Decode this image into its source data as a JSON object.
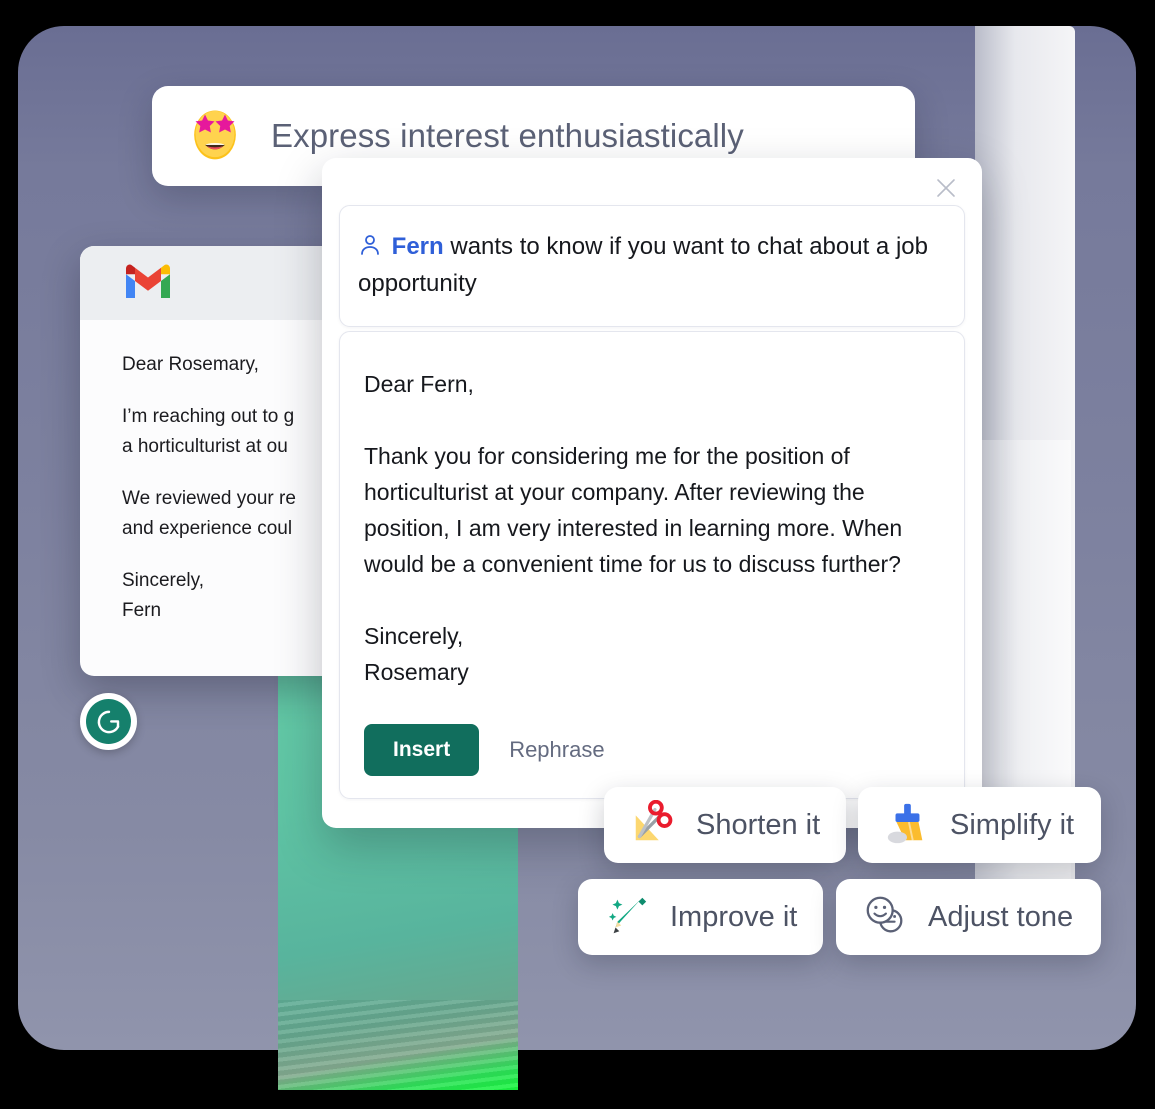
{
  "background": {
    "card_color": "#7d819f",
    "green_panel_color": "#5fc4a4",
    "green_accent": "#18f73f"
  },
  "prompt_pill": {
    "emoji": "star-struck-emoji",
    "text": "Express interest enthusiastically"
  },
  "gmail_window": {
    "logo": "gmail-logo",
    "lines": [
      "Dear Rosemary,",
      "I’m reaching out to g",
      "a horticulturist at ou",
      "We reviewed your re",
      "and experience coul",
      "Sincerely,",
      "Fern"
    ]
  },
  "grammarly_badge": {
    "icon": "grammarly-logo",
    "brand_color": "#15806c"
  },
  "assistant": {
    "close_icon": "close-icon",
    "ask_card": {
      "person_icon": "person-icon",
      "sender": "Fern",
      "sender_color": "#2f5fd8",
      "message": " wants to know if you want to chat about a job opportunity"
    },
    "draft_card": {
      "salutation": "Dear Fern,",
      "body": "Thank you for considering me for the position of horticulturist at your company. After reviewing the position, I am very interested in learning more. When would be a convenient time for us to discuss further?",
      "signoff": "Sincerely,",
      "signature": "Rosemary"
    },
    "actions": {
      "insert_label": "Insert",
      "insert_color": "#116e5d",
      "rephrase_label": "Rephrase"
    }
  },
  "suggestion_pills": [
    {
      "id": "shorten",
      "icon": "scissors-icon",
      "label": "Shorten it"
    },
    {
      "id": "simplify",
      "icon": "broom-icon",
      "label": "Simplify it"
    },
    {
      "id": "improve",
      "icon": "sparkle-pencil-icon",
      "label": "Improve it"
    },
    {
      "id": "tone",
      "icon": "two-faces-icon",
      "label": "Adjust tone"
    }
  ]
}
